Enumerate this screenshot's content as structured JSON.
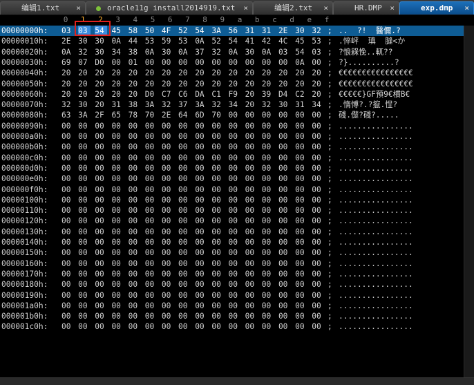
{
  "tabs": [
    {
      "label": "编辑1.txt",
      "close": "×",
      "active": false
    },
    {
      "label": "oracle11g install2014919.txt",
      "close": "×",
      "active": false
    },
    {
      "label": "编辑2.txt",
      "close": "×",
      "active": false
    },
    {
      "label": "HR.DMP",
      "close": "×",
      "active": false
    },
    {
      "label": "exp.dmp",
      "close": "×",
      "active": true
    }
  ],
  "ruler": [
    "0",
    "1",
    "2",
    "3",
    "4",
    "5",
    "6",
    "7",
    "8",
    "9",
    "a",
    "b",
    "c",
    "d",
    "e",
    "f"
  ],
  "rows": [
    {
      "addr": "00000000h:",
      "bytes": [
        "03",
        "03",
        "54",
        "45",
        "58",
        "50",
        "4F",
        "52",
        "54",
        "3A",
        "56",
        "31",
        "31",
        "2E",
        "30",
        "32"
      ],
      "sep": ";",
      "ascii": "..  ?!  醫儞.?"
    },
    {
      "addr": "00000010h:",
      "bytes": [
        "2E",
        "30",
        "30",
        "0A",
        "44",
        "53",
        "59",
        "53",
        "0A",
        "52",
        "54",
        "41",
        "42",
        "4C",
        "45",
        "53"
      ],
      "sep": ";",
      "ascii": ".悴岼  瑱  膖<か"
    },
    {
      "addr": "00000020h:",
      "bytes": [
        "0A",
        "32",
        "30",
        "34",
        "38",
        "0A",
        "30",
        "0A",
        "37",
        "32",
        "0A",
        "30",
        "0A",
        "03",
        "54",
        "03"
      ],
      "sep": ";",
      "ascii": "?悢槑悗..軏??"
    },
    {
      "addr": "00000030h:",
      "bytes": [
        "69",
        "07",
        "D0",
        "00",
        "01",
        "00",
        "00",
        "00",
        "00",
        "00",
        "00",
        "00",
        "00",
        "00",
        "0A",
        "00"
      ],
      "sep": ";",
      "ascii": "?}..........?"
    },
    {
      "addr": "00000040h:",
      "bytes": [
        "20",
        "20",
        "20",
        "20",
        "20",
        "20",
        "20",
        "20",
        "20",
        "20",
        "20",
        "20",
        "20",
        "20",
        "20",
        "20"
      ],
      "sep": ";",
      "ascii": "€€€€€€€€€€€€€€€€"
    },
    {
      "addr": "00000050h:",
      "bytes": [
        "20",
        "20",
        "20",
        "20",
        "20",
        "20",
        "20",
        "20",
        "20",
        "20",
        "20",
        "20",
        "20",
        "20",
        "20",
        "20"
      ],
      "sep": ";",
      "ascii": "€€€€€€€€€€€€€€€€"
    },
    {
      "addr": "00000060h:",
      "bytes": [
        "20",
        "20",
        "20",
        "20",
        "20",
        "D0",
        "C7",
        "C6",
        "DA",
        "C1",
        "F9",
        "20",
        "39",
        "D4",
        "C2",
        "20"
      ],
      "sep": ";",
      "ascii": "€€€€€}GF預9€樌B€"
    },
    {
      "addr": "00000070h:",
      "bytes": [
        "32",
        "30",
        "20",
        "31",
        "38",
        "3A",
        "32",
        "37",
        "3A",
        "32",
        "34",
        "20",
        "32",
        "30",
        "31",
        "34"
      ],
      "sep": ";",
      "ascii": ".惰愽?.?攛.悜?"
    },
    {
      "addr": "00000080h:",
      "bytes": [
        "63",
        "3A",
        "2F",
        "65",
        "78",
        "70",
        "2E",
        "64",
        "6D",
        "70",
        "00",
        "00",
        "00",
        "00",
        "00",
        "00"
      ],
      "sep": ";",
      "ascii": "碊.儊?碊?....."
    },
    {
      "addr": "00000090h:",
      "bytes": [
        "00",
        "00",
        "00",
        "00",
        "00",
        "00",
        "00",
        "00",
        "00",
        "00",
        "00",
        "00",
        "00",
        "00",
        "00",
        "00"
      ],
      "sep": ";",
      "ascii": "................"
    },
    {
      "addr": "000000a0h:",
      "bytes": [
        "00",
        "00",
        "00",
        "00",
        "00",
        "00",
        "00",
        "00",
        "00",
        "00",
        "00",
        "00",
        "00",
        "00",
        "00",
        "00"
      ],
      "sep": ";",
      "ascii": "................"
    },
    {
      "addr": "000000b0h:",
      "bytes": [
        "00",
        "00",
        "00",
        "00",
        "00",
        "00",
        "00",
        "00",
        "00",
        "00",
        "00",
        "00",
        "00",
        "00",
        "00",
        "00"
      ],
      "sep": ";",
      "ascii": "................"
    },
    {
      "addr": "000000c0h:",
      "bytes": [
        "00",
        "00",
        "00",
        "00",
        "00",
        "00",
        "00",
        "00",
        "00",
        "00",
        "00",
        "00",
        "00",
        "00",
        "00",
        "00"
      ],
      "sep": ";",
      "ascii": "................"
    },
    {
      "addr": "000000d0h:",
      "bytes": [
        "00",
        "00",
        "00",
        "00",
        "00",
        "00",
        "00",
        "00",
        "00",
        "00",
        "00",
        "00",
        "00",
        "00",
        "00",
        "00"
      ],
      "sep": ";",
      "ascii": "................"
    },
    {
      "addr": "000000e0h:",
      "bytes": [
        "00",
        "00",
        "00",
        "00",
        "00",
        "00",
        "00",
        "00",
        "00",
        "00",
        "00",
        "00",
        "00",
        "00",
        "00",
        "00"
      ],
      "sep": ";",
      "ascii": "................"
    },
    {
      "addr": "000000f0h:",
      "bytes": [
        "00",
        "00",
        "00",
        "00",
        "00",
        "00",
        "00",
        "00",
        "00",
        "00",
        "00",
        "00",
        "00",
        "00",
        "00",
        "00"
      ],
      "sep": ";",
      "ascii": "................"
    },
    {
      "addr": "00000100h:",
      "bytes": [
        "00",
        "00",
        "00",
        "00",
        "00",
        "00",
        "00",
        "00",
        "00",
        "00",
        "00",
        "00",
        "00",
        "00",
        "00",
        "00"
      ],
      "sep": ";",
      "ascii": "................"
    },
    {
      "addr": "00000110h:",
      "bytes": [
        "00",
        "00",
        "00",
        "00",
        "00",
        "00",
        "00",
        "00",
        "00",
        "00",
        "00",
        "00",
        "00",
        "00",
        "00",
        "00"
      ],
      "sep": ";",
      "ascii": "................"
    },
    {
      "addr": "00000120h:",
      "bytes": [
        "00",
        "00",
        "00",
        "00",
        "00",
        "00",
        "00",
        "00",
        "00",
        "00",
        "00",
        "00",
        "00",
        "00",
        "00",
        "00"
      ],
      "sep": ";",
      "ascii": "................"
    },
    {
      "addr": "00000130h:",
      "bytes": [
        "00",
        "00",
        "00",
        "00",
        "00",
        "00",
        "00",
        "00",
        "00",
        "00",
        "00",
        "00",
        "00",
        "00",
        "00",
        "00"
      ],
      "sep": ";",
      "ascii": "................"
    },
    {
      "addr": "00000140h:",
      "bytes": [
        "00",
        "00",
        "00",
        "00",
        "00",
        "00",
        "00",
        "00",
        "00",
        "00",
        "00",
        "00",
        "00",
        "00",
        "00",
        "00"
      ],
      "sep": ";",
      "ascii": "................"
    },
    {
      "addr": "00000150h:",
      "bytes": [
        "00",
        "00",
        "00",
        "00",
        "00",
        "00",
        "00",
        "00",
        "00",
        "00",
        "00",
        "00",
        "00",
        "00",
        "00",
        "00"
      ],
      "sep": ";",
      "ascii": "................"
    },
    {
      "addr": "00000160h:",
      "bytes": [
        "00",
        "00",
        "00",
        "00",
        "00",
        "00",
        "00",
        "00",
        "00",
        "00",
        "00",
        "00",
        "00",
        "00",
        "00",
        "00"
      ],
      "sep": ";",
      "ascii": "................"
    },
    {
      "addr": "00000170h:",
      "bytes": [
        "00",
        "00",
        "00",
        "00",
        "00",
        "00",
        "00",
        "00",
        "00",
        "00",
        "00",
        "00",
        "00",
        "00",
        "00",
        "00"
      ],
      "sep": ";",
      "ascii": "................"
    },
    {
      "addr": "00000180h:",
      "bytes": [
        "00",
        "00",
        "00",
        "00",
        "00",
        "00",
        "00",
        "00",
        "00",
        "00",
        "00",
        "00",
        "00",
        "00",
        "00",
        "00"
      ],
      "sep": ";",
      "ascii": "................"
    },
    {
      "addr": "00000190h:",
      "bytes": [
        "00",
        "00",
        "00",
        "00",
        "00",
        "00",
        "00",
        "00",
        "00",
        "00",
        "00",
        "00",
        "00",
        "00",
        "00",
        "00"
      ],
      "sep": ";",
      "ascii": "................"
    },
    {
      "addr": "000001a0h:",
      "bytes": [
        "00",
        "00",
        "00",
        "00",
        "00",
        "00",
        "00",
        "00",
        "00",
        "00",
        "00",
        "00",
        "00",
        "00",
        "00",
        "00"
      ],
      "sep": ";",
      "ascii": "................"
    },
    {
      "addr": "000001b0h:",
      "bytes": [
        "00",
        "00",
        "00",
        "00",
        "00",
        "00",
        "00",
        "00",
        "00",
        "00",
        "00",
        "00",
        "00",
        "00",
        "00",
        "00"
      ],
      "sep": ";",
      "ascii": "................"
    },
    {
      "addr": "000001c0h:",
      "bytes": [
        "00",
        "00",
        "00",
        "00",
        "00",
        "00",
        "00",
        "00",
        "00",
        "00",
        "00",
        "00",
        "00",
        "00",
        "00",
        "00"
      ],
      "sep": ";",
      "ascii": "................"
    }
  ],
  "selected_row": 0,
  "highlighted_bytes": {
    "row": 0,
    "cols": [
      1,
      2
    ]
  },
  "colors": {
    "background": "#000000",
    "text": "#d2d2d2",
    "selection_row": "#0e5c94",
    "active_tab": "#1d6fb8",
    "highlight_box": "#e0211c",
    "ruler_tick": "#ffb030"
  }
}
